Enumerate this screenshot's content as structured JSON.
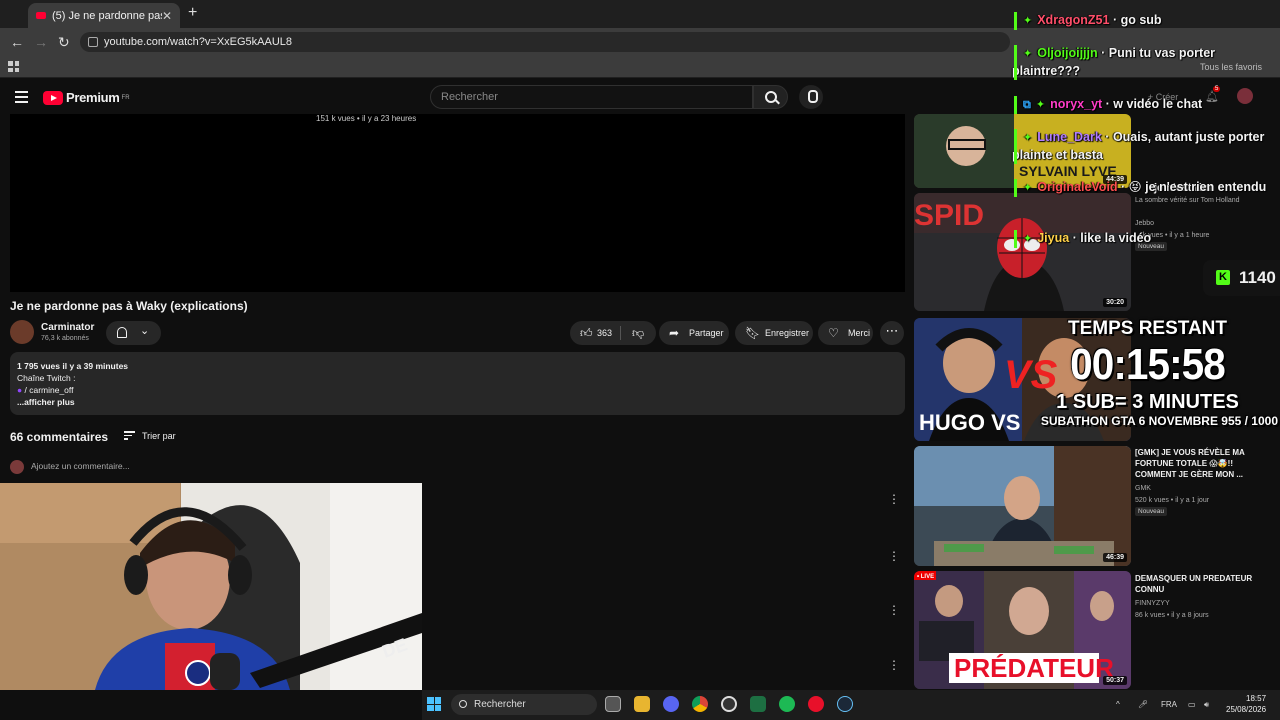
{
  "browser": {
    "tab_title": "(5) Je ne pardonne pas à Waky",
    "url": "youtube.com/watch?v=XxEG5kAAUL8",
    "favorites": "Tous les favoris"
  },
  "header": {
    "logo_text": "Premium",
    "logo_region": "FR",
    "search_placeholder": "Rechercher"
  },
  "player": {
    "overlay_meta": "151 k vues • il y a 23 heures"
  },
  "video": {
    "title": "Je ne pardonne pas à Waky (explications)",
    "channel": "Carminator",
    "subscribers": "76,3 k abonnés",
    "likes": "363",
    "share_label": "Partager",
    "save_label": "Enregistrer",
    "thanks_label": "Merci"
  },
  "description": {
    "stats": "1 795 vues  il y a 39 minutes",
    "line1": "Chaîne Twitch :",
    "line2": "/ carmine_off",
    "more": "...afficher plus"
  },
  "comments": {
    "count": "66 commentaires",
    "sort_label": "Trier par",
    "add_placeholder": "Ajoutez un commentaire..."
  },
  "recommendations": [
    {
      "title": "je n'est rien",
      "meta1": "La sombre vérité sur Tom Holland",
      "meta2": "Jebbo",
      "meta3": "... k vues • il y a 1 heure",
      "badge": "Nouveau",
      "duration": "30:20"
    },
    {
      "title": "",
      "meta1": "",
      "meta2": "",
      "badge": "",
      "duration": ""
    },
    {
      "title": "[GMK] JE VOUS RÉVÈLE MA FORTUNE TOTALE 😱🤯!! COMMENT JE GÈRE MON ...",
      "meta1": "GMK",
      "meta2": "520 k vues • il y a 1 jour",
      "badge": "Nouveau",
      "duration": "46:39"
    },
    {
      "title": "DEMASQUER UN PREDATEUR CONNU",
      "meta1": "FINNYZYY",
      "meta2": "86 k vues • il y a 8 jours",
      "badge": "",
      "duration": "50:37"
    }
  ],
  "thumb_texts": {
    "react": "SYLVAIN LYVE",
    "hugo": "HUGO VS",
    "live": "• LIVE",
    "predateur": "PRÉDATEUR",
    "duration_react": "44:39"
  },
  "overlay": {
    "timer_label": "TEMPS RESTANT",
    "timer": "00:15:58",
    "rule": "1 SUB= 3 MINUTES",
    "subathon": "SUBATHON GTA 6 NOVEMBRE 955 / 1000",
    "kick_count": "1140",
    "kick_letter": "K"
  },
  "chat": [
    {
      "user": "XdragonZ51",
      "color": "#ff4f6a",
      "text": "go sub"
    },
    {
      "user": "Oljoijoijjjn",
      "color": "#53fc18",
      "text": "Puni tu vas porter plaintre???"
    },
    {
      "user": "noryx_yt",
      "color": "#ff3cc7",
      "text": "w vidéo le chat"
    },
    {
      "user": "Lune_Dark",
      "color": "#b07cff",
      "text": "Ouais, autant juste porter plainte et basta"
    },
    {
      "user": "OriginaleVoid",
      "color": "#ff4f4f",
      "text": "😝 je n'est rien entendu"
    },
    {
      "user": "Jiyua",
      "color": "#ffd24a",
      "text": "like la vidéo"
    }
  ],
  "yt_right": {
    "create": "Créer",
    "notif": "5"
  },
  "taskbar": {
    "search": "Rechercher",
    "lang": "FRA",
    "time": "18:57",
    "date": "25/08/2026"
  },
  "colors": {
    "accent": "#ff0033",
    "kick": "#53fc18",
    "background": "#0f0f0f"
  }
}
